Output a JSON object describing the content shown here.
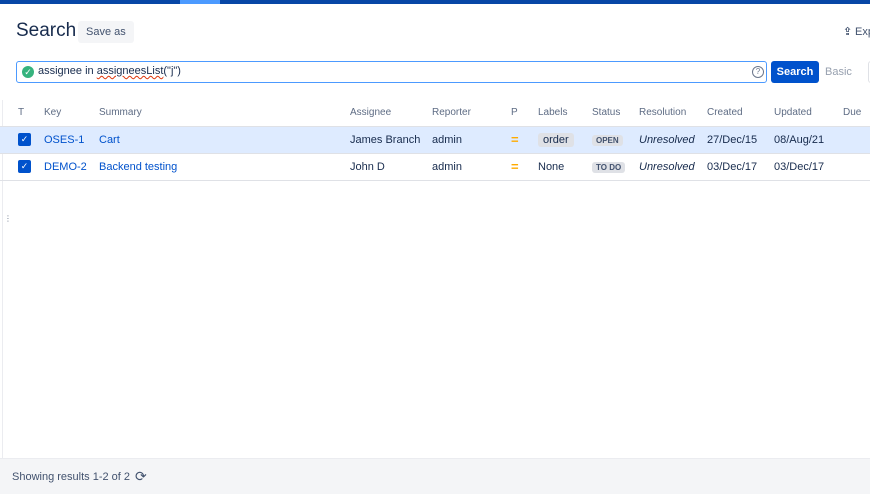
{
  "header": {
    "title": "Search",
    "save_as_label": "Save as",
    "export_label": "Exp"
  },
  "jql": {
    "prefix": "assignee in ",
    "function": "assigneesList",
    "args": "(\"j\")",
    "search_label": "Search",
    "basic_label": "Basic",
    "status_icon": "check-circle-icon",
    "help_icon": "question-circle-icon"
  },
  "table": {
    "columns": [
      "T",
      "Key",
      "Summary",
      "Assignee",
      "Reporter",
      "P",
      "Labels",
      "Status",
      "Resolution",
      "Created",
      "Updated",
      "Due"
    ],
    "rows": [
      {
        "key": "OSES-1",
        "summary": "Cart",
        "assignee": "James Branch",
        "reporter": "admin",
        "priority": "=",
        "labels": "order",
        "status": "OPEN",
        "resolution": "Unresolved",
        "created": "27/Dec/15",
        "updated": "08/Aug/21",
        "due": ""
      },
      {
        "key": "DEMO-2",
        "summary": "Backend testing",
        "assignee": "John D",
        "reporter": "admin",
        "priority": "=",
        "labels": "None",
        "status": "TO DO",
        "resolution": "Unresolved",
        "created": "03/Dec/17",
        "updated": "03/Dec/17",
        "due": ""
      }
    ]
  },
  "footer": {
    "results_text": "Showing results 1-2 of 2",
    "refresh_icon": "refresh-icon"
  },
  "colors": {
    "primary": "#0052cc",
    "selected_row": "#deebff",
    "priority_medium": "#ffab00",
    "ok_green": "#36b37e"
  }
}
